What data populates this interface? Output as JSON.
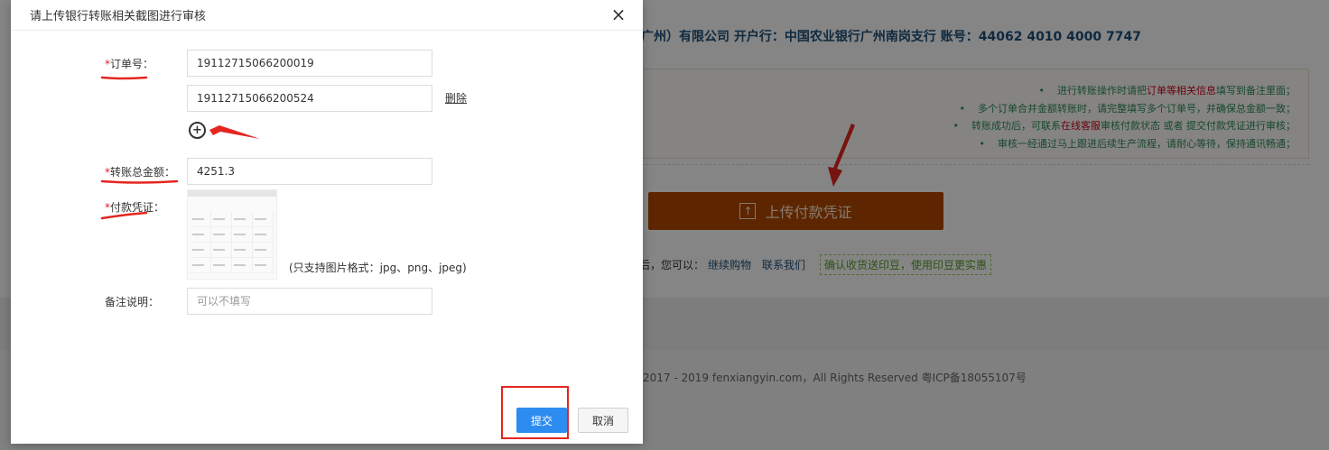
{
  "background": {
    "account_line": "广州）有限公司  开户行：中国农业银行广州南岗支行  账号：44062 4010 4000 7747",
    "notes": [
      {
        "pre": "进行转账操作时请把",
        "red": "订单等相关信息",
        "post": "填写到备注里面；"
      },
      {
        "pre": "多个订单合并金额转账时，请完整填写多个订单号，并确保总金额一致；",
        "red": "",
        "post": ""
      },
      {
        "pre": "转账成功后，可联系",
        "red": "在线客服",
        "post": "审核付款状态 或者 提交付款凭证进行审核；"
      },
      {
        "pre": "审核一经通过马上跟进后续生产流程，请耐心等待，保持通讯畅通；",
        "red": "",
        "post": ""
      }
    ],
    "upload_button": "上传付款凭证",
    "upload_icon": "upload-icon",
    "after_text": "后，您可以：",
    "continue_link": "继续购物",
    "contact_link": "联系我们",
    "confirm_tag": "确认收货送印豆，使用印豆更实惠",
    "footer": "2017 - 2019 fenxiangyin.com，All Rights Reserved 粤ICP备18055107号",
    "colors": {
      "upload_bg": "#b24a00",
      "account_text": "#1d4f7a",
      "notes_text": "#2e8b57",
      "notes_red": "#d0021b"
    }
  },
  "modal": {
    "title": "请上传银行转账相关截图进行审核",
    "close_icon": "×",
    "order_label_req": "*",
    "order_label": "订单号：",
    "order_numbers": [
      "19112715066200019",
      "19112715066200524"
    ],
    "delete_label": "删除",
    "add_icon": "+",
    "amount_label_req": "*",
    "amount_label": "转账总金额：",
    "amount_value": "4251.3",
    "voucher_label_req": "*",
    "voucher_label": "付款凭证：",
    "voucher_format_hint": "(只支持图片格式：jpg、png、jpeg)",
    "remark_label": "备注说明：",
    "remark_placeholder": "可以不填写",
    "submit_label": "提交",
    "cancel_label": "取消",
    "colors": {
      "submit_bg": "#2d8cf0",
      "required": "#e02020",
      "annotation": "#e52520"
    }
  }
}
